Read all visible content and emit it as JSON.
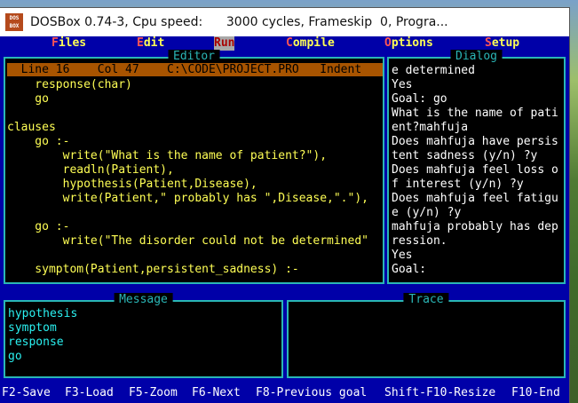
{
  "window": {
    "title": "DOSBox 0.74-3, Cpu speed:      3000 cycles, Frameskip  0, Progra..."
  },
  "menu": {
    "files": [
      "F",
      "iles"
    ],
    "edit": [
      "E",
      "dit"
    ],
    "run": [
      "R",
      "un"
    ],
    "compile": [
      "C",
      "ompile"
    ],
    "options": [
      "O",
      "ptions"
    ],
    "setup": [
      "S",
      "etup"
    ]
  },
  "editor": {
    "title": "Editor",
    "status": "  Line 16    Col 47    C:\\CODE\\PROJECT.PRO   Indent",
    "lines": [
      "    response(char)",
      "    go",
      "",
      "clauses",
      "    go :-",
      "        write(\"What is the name of patient?\"),",
      "        readln(Patient),",
      "        hypothesis(Patient,Disease),",
      "        write(Patient,\" probably has \",Disease,\".\"),",
      "",
      "    go :-",
      "        write(\"The disorder could not be determined\"",
      "",
      "    symptom(Patient,persistent_sadness) :-"
    ]
  },
  "dialog": {
    "title": "Dialog",
    "lines": [
      "e determined",
      "Yes",
      "Goal: go",
      "What is the name of pati",
      "ent?mahfuja",
      "Does mahfuja have persis",
      "tent sadness (y/n) ?y",
      "Does mahfuja feel loss o",
      "f interest (y/n) ?y",
      "Does mahfuja feel fatigu",
      "e (y/n) ?y",
      "mahfuja probably has dep",
      "ression.",
      "Yes",
      "Goal:"
    ]
  },
  "message": {
    "title": "Message",
    "lines": [
      "hypothesis",
      "symptom",
      "response",
      "go"
    ]
  },
  "trace": {
    "title": "Trace"
  },
  "fkeys": {
    "save": "F2-Save",
    "load": "F3-Load",
    "zoom": "F5-Zoom",
    "next": "F6-Next",
    "prevgoal": "F8-Previous goal",
    "resize": "Shift-F10-Resize",
    "end": "F10-End"
  },
  "colors": {
    "background": "#0000a8",
    "border": "#2ab6b6",
    "code": "#ffff55",
    "status_bar": "#a85400"
  }
}
